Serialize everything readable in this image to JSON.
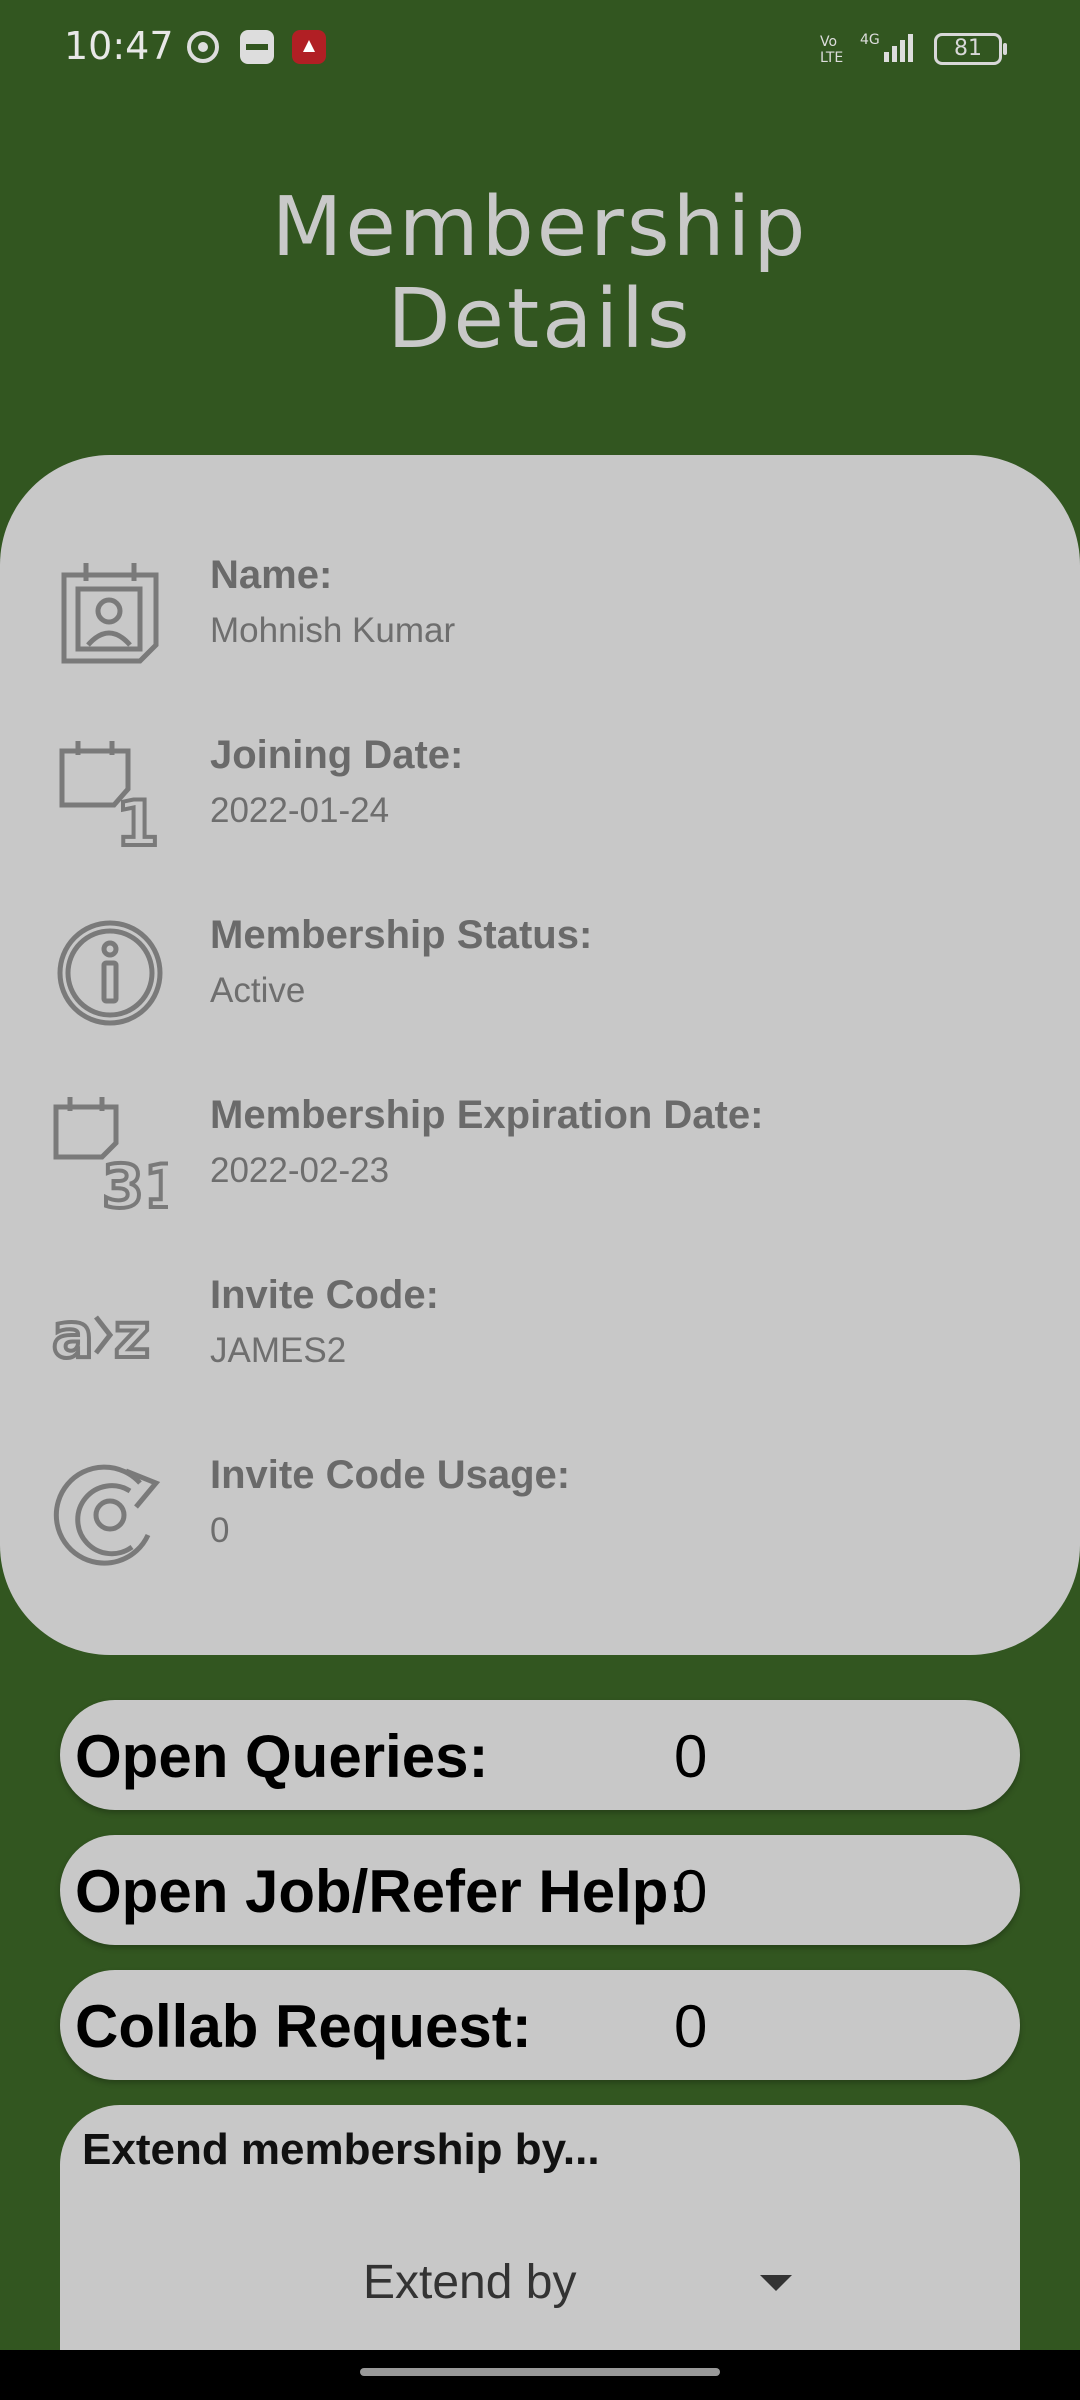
{
  "status": {
    "time": "10:47",
    "battery": "81"
  },
  "title": {
    "line1": "Membership",
    "line2": "Details"
  },
  "details": [
    {
      "label": "Name:",
      "value": "Mohnish Kumar",
      "icon": "contact-card-icon"
    },
    {
      "label": "Joining Date:",
      "value": "2022-01-24",
      "icon": "calendar-day-1-icon"
    },
    {
      "label": "Membership Status:",
      "value": "Active",
      "icon": "info-icon"
    },
    {
      "label": "Membership Expiration Date:",
      "value": "2022-02-23",
      "icon": "calendar-day-31-icon"
    },
    {
      "label": "Invite Code:",
      "value": "JAMES2",
      "icon": "a-to-z-icon"
    },
    {
      "label": "Invite Code Usage:",
      "value": "0",
      "icon": "reuse-icon"
    }
  ],
  "stats": [
    {
      "label": "Open Queries:",
      "value": "0"
    },
    {
      "label": "Open Job/Refer Help:",
      "value": "0"
    },
    {
      "label": "Collab Request:",
      "value": "0"
    }
  ],
  "extend": {
    "title": "Extend membership by...",
    "select_value": "Extend by"
  },
  "colors": {
    "background": "#325620",
    "card": "#c8c8c8"
  }
}
